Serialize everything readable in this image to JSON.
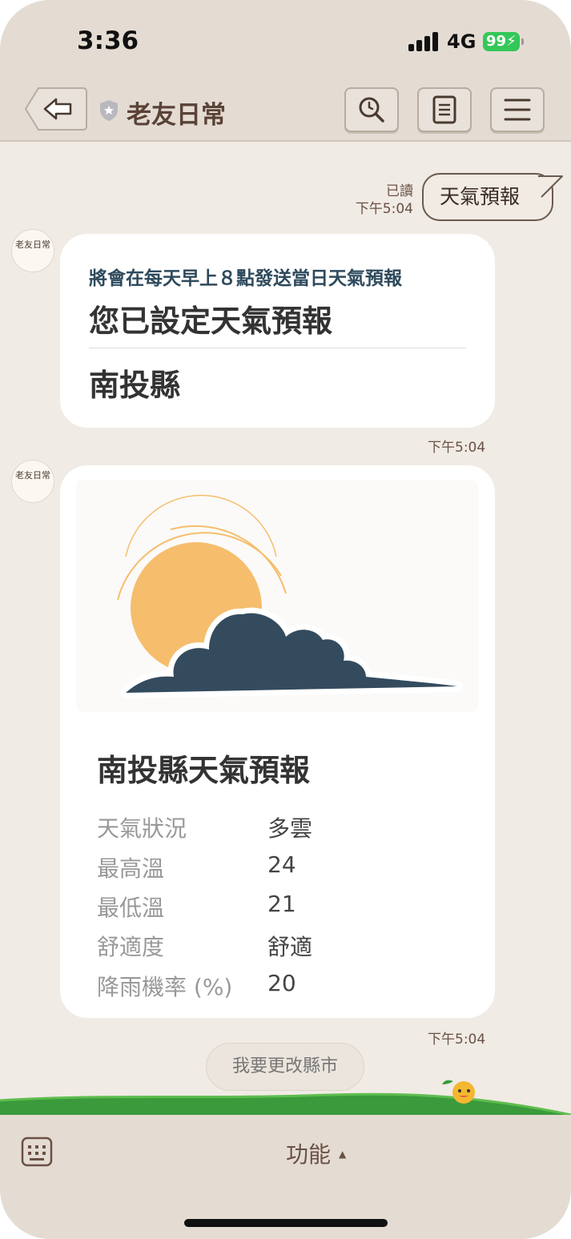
{
  "status_bar": {
    "time": "3:36",
    "network": "4G",
    "battery": "99"
  },
  "header": {
    "title": "老友日常"
  },
  "conversation": {
    "outgoing": {
      "read_label": "已讀",
      "time": "下午5:04",
      "text": "天氣預報"
    },
    "card1": {
      "subtitle": "將會在每天早上８點發送當日天氣預報",
      "title": "您已設定天氣預報",
      "county": "南投縣",
      "time": "下午5:04"
    },
    "card2": {
      "title": "南投縣天氣預報",
      "rows": [
        {
          "label": "天氣狀況",
          "value": "多雲"
        },
        {
          "label": "最高溫",
          "value": "24"
        },
        {
          "label": "最低溫",
          "value": "21"
        },
        {
          "label": "舒適度",
          "value": "舒適"
        },
        {
          "label": "降雨機率 (%)",
          "value": "20"
        }
      ],
      "time": "下午5:04"
    },
    "avatar_text": "老友日常"
  },
  "quick_reply": "我要更改縣市",
  "bottom_bar": {
    "function_label": "功能",
    "caret": "▲"
  },
  "colors": {
    "background": "#f0ebe5",
    "bar": "#e4dcd3",
    "accent": "#6b5044",
    "sun": "#f6bd6d",
    "cloud": "#344b5e"
  }
}
